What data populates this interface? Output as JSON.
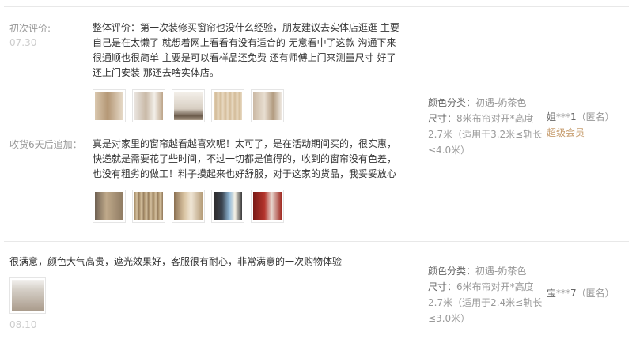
{
  "reviews": [
    {
      "initial_label": "初次评价:",
      "initial_date": "07.30",
      "initial_text": "整体评价：第一次装修买窗帘也没什么经验，朋友建议去实体店逛逛 主要自己是在太懒了 就想着网上看看有没有适合的 无意看中了这款 沟通下来很通顺也很简单 主要是可以看样品还免费 还有师傅上门来测量尺寸 好了还上门安装 那还去啥实体店。",
      "initial_images": [
        "curtain-photo-1",
        "curtain-photo-2",
        "curtain-photo-3",
        "curtain-photo-4",
        "curtain-photo-5"
      ],
      "followup_label": "收货6天后追加：",
      "followup_text": "真是对家里的窗帘越看越喜欢呢！太可了，是在活动期间买的，很实惠，快递就是需要花了些时间，不过一切都是值得的，收到的窗帘没有色差，也没有粗劣的做工！料子摸起来也好舒服，对于这家的货品，我妥妥放心",
      "followup_images": [
        "curtain-photo-6",
        "curtain-photo-7",
        "curtain-photo-8",
        "curtain-photo-9",
        "curtain-photo-10"
      ],
      "sku_color_key": "颜色分类：",
      "sku_color_val": "初遇-奶茶色",
      "sku_size_key": "尺寸：",
      "sku_size_val": "8米布帘对开*高度2.7米（适用于3.2米≤轨长≤4.0米）",
      "user_name": "姐",
      "user_stars": "***",
      "user_suffix": "1",
      "user_anon": "（匿名）",
      "user_level": "超级会员"
    },
    {
      "text": "很满意，颜色大气高贵，遮光效果好，客服很有耐心，非常满意的一次购物体验",
      "images": [
        "curtain-photo-11"
      ],
      "date": "08.10",
      "sku_color_key": "颜色分类：",
      "sku_color_val": "初遇-奶茶色",
      "sku_size_key": "尺寸：",
      "sku_size_val": "6米布帘对开*高度2.7米（适用于2.4米≤轨长≤3.0米）",
      "user_name": "宝",
      "user_stars": "***",
      "user_suffix": "7",
      "user_anon": "（匿名）"
    }
  ]
}
